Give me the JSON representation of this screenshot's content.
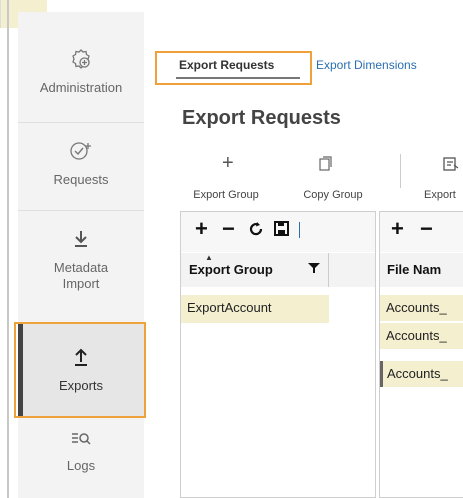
{
  "sidebar": {
    "items": [
      {
        "label": "Administration",
        "icon": "admin-gear-plus-icon"
      },
      {
        "label": "Requests",
        "icon": "check-plus-icon"
      },
      {
        "label": "Metadata Import",
        "label_line1": "Metadata",
        "label_line2": "Import",
        "icon": "import-arrow-down-icon"
      },
      {
        "label": "Exports",
        "icon": "export-arrow-up-icon",
        "active": true
      },
      {
        "label": "Logs",
        "icon": "logs-search-icon"
      }
    ]
  },
  "tabs": [
    {
      "label": "Export Requests",
      "active": true
    },
    {
      "label": "Export Dimensions",
      "active": false
    }
  ],
  "page": {
    "title": "Export Requests"
  },
  "toolbar": {
    "export_group_label": "Export Group",
    "copy_group_label": "Copy Group",
    "export_label": "Export"
  },
  "left_grid": {
    "column_header": "Export Group",
    "rows": [
      "ExportAccount"
    ]
  },
  "right_grid": {
    "column_header": "File Nam",
    "rows": [
      "Accounts_",
      "Accounts_",
      "Accounts_"
    ]
  },
  "colors": {
    "highlight": "#f0a23a",
    "link": "#2a6fb0",
    "row_selected": "#f3efcf"
  }
}
